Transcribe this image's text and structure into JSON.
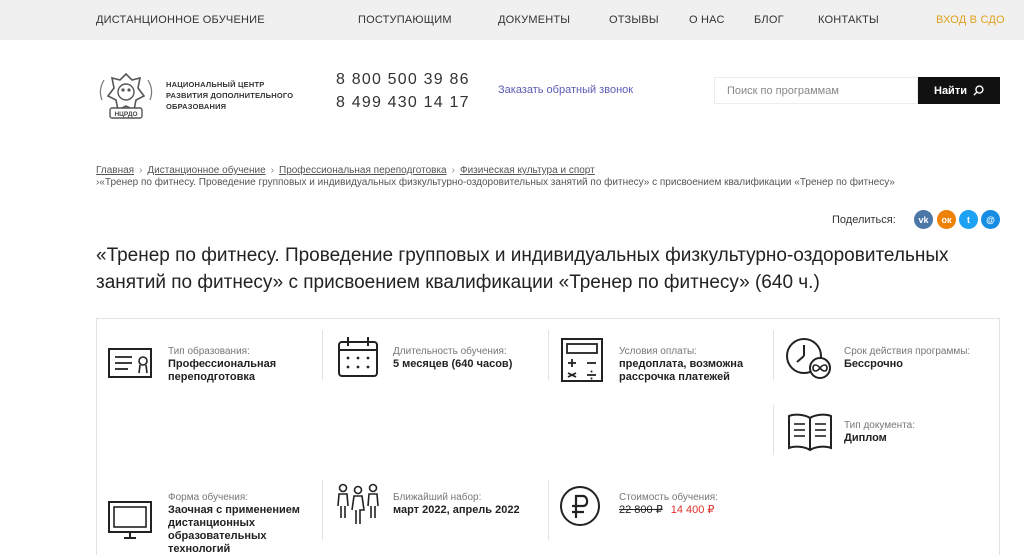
{
  "topnav": {
    "items": [
      "ДИСТАНЦИОННОЕ ОБУЧЕНИЕ",
      "ПОСТУПАЮЩИМ",
      "ДОКУМЕНТЫ",
      "ОТЗЫВЫ",
      "О НАС",
      "БЛОГ",
      "КОНТАКТЫ"
    ],
    "login": "ВХОД В СДО"
  },
  "header": {
    "logo_text": "НЦРДО",
    "org_name_line1": "НАЦИОНАЛЬНЫЙ ЦЕНТР",
    "org_name_line2": "РАЗВИТИЯ ДОПОЛНИТЕЛЬНОГО",
    "org_name_line3": "ОБРАЗОВАНИЯ",
    "phones": [
      "8 800 500 39 86",
      "8 499 430 14 17"
    ],
    "callback": "Заказать обратный звонок",
    "search_placeholder": "Поиск по программам",
    "search_button": "Найти"
  },
  "breadcrumb": {
    "items": [
      "Главная",
      "Дистанционное обучение",
      "Профессиональная переподготовка",
      "Физическая культура и спорт"
    ],
    "current": "«Тренер по фитнесу. Проведение групповых и индивидуальных физкультурно-оздоровительных занятий по фитнесу» с присвоением квалификации «Тренер по фитнесу»",
    "separator": "›"
  },
  "share": {
    "label": "Поделиться:",
    "icons": [
      {
        "name": "vk",
        "glyph": "vk",
        "color": "#4a76a8"
      },
      {
        "name": "odnoklassniki",
        "glyph": "ок",
        "color": "#ee8208"
      },
      {
        "name": "twitter",
        "glyph": "t",
        "color": "#1da1f2"
      },
      {
        "name": "moimir",
        "glyph": "@",
        "color": "#168de2"
      }
    ]
  },
  "page_title": "«Тренер по фитнесу. Проведение групповых и индивидуальных физкультурно-оздоровительных занятий по фитнесу» с присвоением квалификации «Тренер по фитнесу» (640 ч.)",
  "info": {
    "education_type": {
      "label": "Тип образования:",
      "value": "Профессиональная переподготовка",
      "icon": "certificate-icon"
    },
    "duration": {
      "label": "Длительность обучения:",
      "value": "5 месяцев (640 часов)",
      "icon": "calendar-icon"
    },
    "payment": {
      "label": "Условия оплаты:",
      "value": "предоплата, возможна рассрочка платежей",
      "icon": "calculator-icon"
    },
    "validity": {
      "label": "Срок действия программы:",
      "value": "Бессрочно",
      "icon": "clock-infinity-icon"
    },
    "document": {
      "label": "Тип документа:",
      "value": "Диплом",
      "icon": "book-icon"
    },
    "form": {
      "label": "Форма обучения:",
      "value": "Заочная с применением дистанционных образовательных технологий",
      "icon": "monitor-icon"
    },
    "enrollment": {
      "label": "Ближайший набор:",
      "value": "март 2022, апрель 2022",
      "icon": "people-icon"
    },
    "cost": {
      "label": "Стоимость обучения:",
      "old_price": "22 800 ₽",
      "new_price": "14 400 ₽",
      "icon": "ruble-icon"
    }
  },
  "colors": {
    "topnav_bg": "#f0f0f0",
    "login_accent": "#e0a020",
    "callback_link": "#5b5bb5",
    "search_button_bg": "#111111",
    "price_accent": "#e0302a"
  }
}
